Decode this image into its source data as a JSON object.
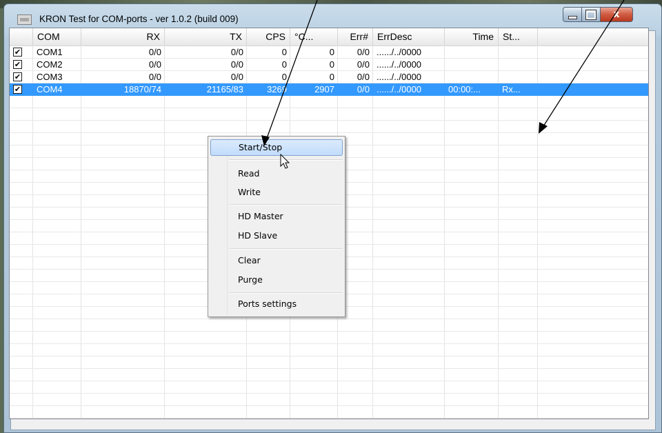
{
  "window": {
    "title": "KRON Test for COM-ports - ver 1.0.2 (build 009)",
    "controls": {
      "minimize": "minimize",
      "maximize": "maximize",
      "close": "x"
    }
  },
  "listview": {
    "columns": [
      "",
      "COM",
      "RX",
      "TX",
      "CPS",
      "°C...",
      "Err#",
      "ErrDesc",
      "Time",
      "St..."
    ],
    "rows": [
      {
        "checked": true,
        "cells": [
          "COM1",
          "0/0",
          "0/0",
          "0",
          "0",
          "0/0",
          "....../../0000",
          "",
          ""
        ]
      },
      {
        "checked": true,
        "cells": [
          "COM2",
          "0/0",
          "0/0",
          "0",
          "0",
          "0/0",
          "....../../0000",
          "",
          ""
        ]
      },
      {
        "checked": true,
        "cells": [
          "COM3",
          "0/0",
          "0/0",
          "0",
          "0",
          "0/0",
          "....../../0000",
          "",
          ""
        ]
      },
      {
        "checked": true,
        "selected": true,
        "cells": [
          "COM4",
          "18870/74",
          "21165/83",
          "3269",
          "2907",
          "0/0",
          "....../../0000",
          "00:00:...",
          "Rx..."
        ]
      }
    ],
    "checkmark": "✔"
  },
  "context_menu": {
    "items": [
      "Start/Stop",
      "Read",
      "Write",
      "HD Master",
      "HD Slave",
      "Clear",
      "Purge",
      "Ports settings"
    ],
    "highlighted": "Start/Stop"
  },
  "colors": {
    "selection": "#3399ff",
    "menu_highlight": "#c1dcfb",
    "close_button": "#cf5a40"
  }
}
